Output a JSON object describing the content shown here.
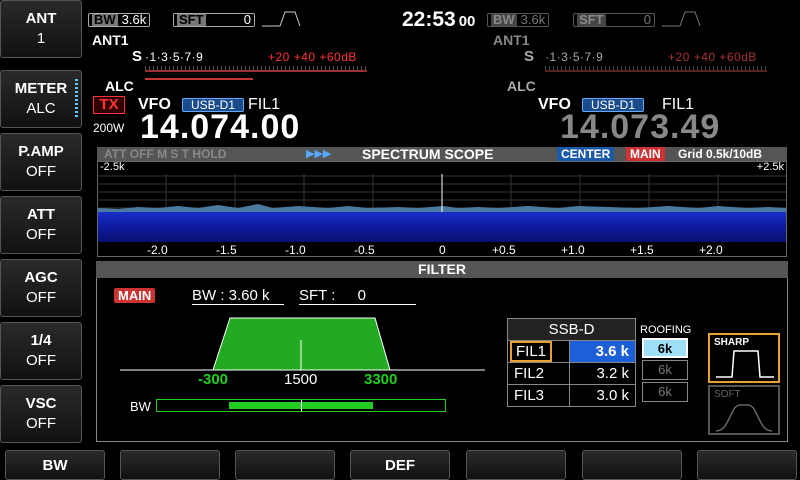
{
  "sidebar": [
    {
      "label": "ANT",
      "value": "1"
    },
    {
      "label": "METER",
      "value": "ALC"
    },
    {
      "label": "P.AMP",
      "value": "OFF"
    },
    {
      "label": "ATT",
      "value": "OFF"
    },
    {
      "label": "AGC",
      "value": "OFF"
    },
    {
      "label": "1/4",
      "value": "OFF"
    },
    {
      "label": "VSC",
      "value": "OFF"
    }
  ],
  "top": {
    "time": "22:53",
    "seconds": "00",
    "main_bw_label": "BW",
    "main_bw": "3.6k",
    "main_sft_label": "SFT",
    "main_sft": "0",
    "sub_bw_label": "BW",
    "sub_bw": "3.6k",
    "sub_sft_label": "SFT",
    "sub_sft": "0"
  },
  "main_vfo": {
    "ant": "ANT1",
    "s_label": "S",
    "s_scale": "·1·3·5·7·9",
    "s_over": "+20 +40 +60dB",
    "alc": "ALC",
    "tx": "TX",
    "power": "200W",
    "vfo": "VFO",
    "mode": "USB-D1",
    "fil": "FIL1",
    "freq": "14.074.00"
  },
  "sub_vfo": {
    "ant": "ANT1",
    "s_label": "S",
    "s_scale": "·1·3·5·7·9",
    "s_over": "+20 +40 +60dB",
    "alc": "ALC",
    "vfo": "VFO",
    "mode": "USB-D1",
    "fil": "FIL1",
    "freq": "14.073.49"
  },
  "scope": {
    "status": "ATT OFF  M  S  T  HOLD",
    "arrows": "▶▶▶",
    "title": "SPECTRUM  SCOPE",
    "center": "CENTER",
    "main": "MAIN",
    "grid": "Grid 0.5k/10dB",
    "left_span": "-2.5k",
    "right_span": "+2.5k",
    "ticks": [
      "-2.0",
      "-1.5",
      "-1.0",
      "-0.5",
      "0",
      "+0.5",
      "+1.0",
      "+1.5",
      "+2.0"
    ]
  },
  "filter": {
    "title": "FILTER",
    "main": "MAIN",
    "bw_label": "BW : ",
    "bw_value": "3.60 k",
    "sft_label": "SFT : ",
    "sft_value": "0",
    "low": "-300",
    "center": "1500",
    "high": "3300",
    "bw_bar_label": "BW",
    "bw_bar_fill": 0.5,
    "table_title": "SSB-D",
    "rows": [
      {
        "name": "FIL1",
        "bw": "3.6 k"
      },
      {
        "name": "FIL2",
        "bw": "3.2 k"
      },
      {
        "name": "FIL3",
        "bw": "3.0 k"
      }
    ],
    "roofing_label": "ROOFING",
    "roofing": [
      "6k",
      "6k",
      "6k"
    ],
    "sharp": "SHARP",
    "soft": "SOFT"
  },
  "fkeys": [
    "BW",
    "",
    "",
    "DEF",
    "",
    "",
    ""
  ],
  "colors": {
    "accent": "#22cc22",
    "tx": "#ff3333",
    "mode": "#1a4c8c",
    "selected": "#1d5fd6"
  }
}
